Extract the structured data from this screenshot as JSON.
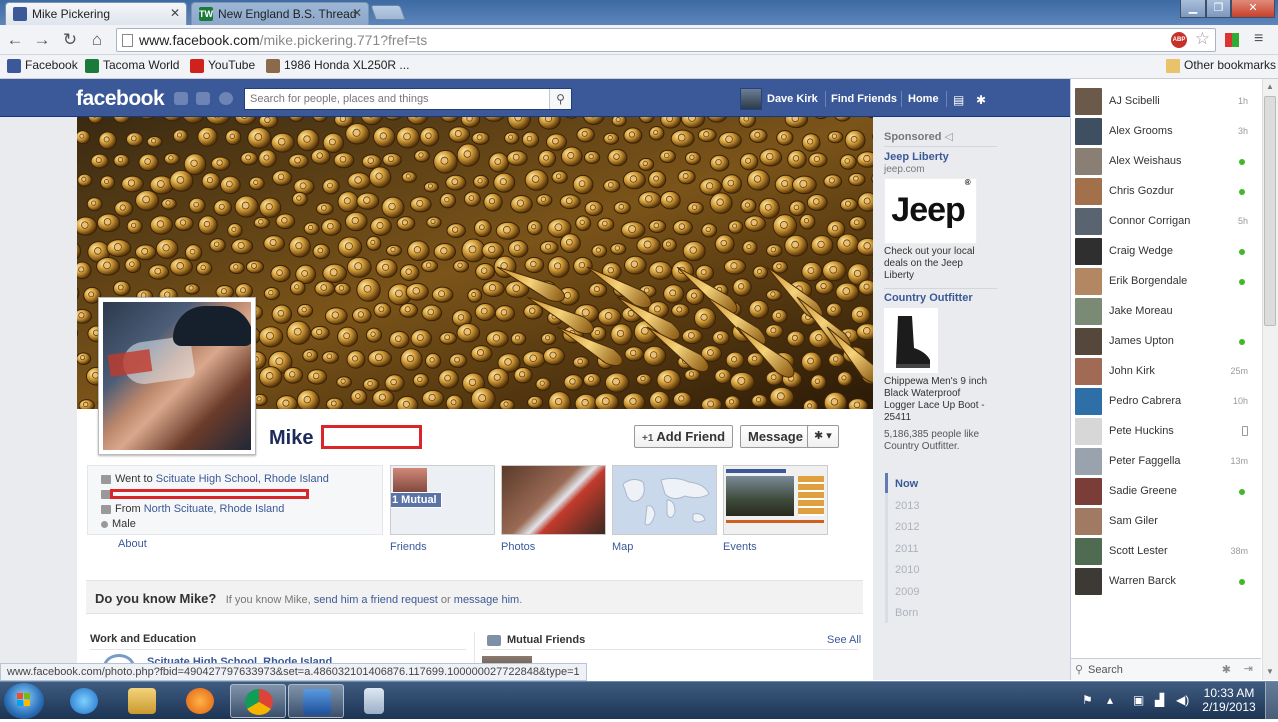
{
  "browser": {
    "tabs": [
      {
        "title": "Mike Pickering",
        "active": true
      },
      {
        "title": "New England B.S. Thread",
        "active": false
      }
    ],
    "url_host": "www.facebook.com",
    "url_rest": "/mike.pickering.771?fref=ts",
    "abp_badge": "ABP",
    "bookmarks": [
      "Facebook",
      "Tacoma World",
      "YouTube",
      "1986 Honda XL250R ..."
    ],
    "other_bookmarks": "Other bookmarks",
    "status_url": "www.facebook.com/photo.php?fbid=490427797633973&set=a.486032101406876.117699.100000027722848&type=1"
  },
  "facebook": {
    "logo": "facebook",
    "search_placeholder": "Search for people, places and things",
    "user_name": "Dave Kirk",
    "find_friends": "Find Friends",
    "home": "Home"
  },
  "profile": {
    "first_name": "Mike",
    "add_friend": "Add Friend",
    "add_friend_icon": "+1",
    "message": "Message",
    "about": {
      "school_prefix": "Went to ",
      "school": "Scituate High School, Rhode Island",
      "from_prefix": "From ",
      "hometown": "North Scituate, Rhode Island",
      "gender": "Male",
      "label": "About"
    },
    "tiles": [
      {
        "label": "Friends",
        "overlay": "1 Mutual"
      },
      {
        "label": "Photos"
      },
      {
        "label": "Map"
      },
      {
        "label": "Events"
      }
    ],
    "know_title": "Do you know Mike?",
    "know_sub_1": "If you know Mike, ",
    "know_link_1": "send him a friend request",
    "know_sub_2": " or ",
    "know_link_2": "message him",
    "know_sub_3": ".",
    "work_heading": "Work and Education",
    "work_item": "Scituate High School, Rhode Island",
    "mutual_heading": "Mutual Friends",
    "see_all": "See All"
  },
  "sidebar": {
    "sponsored": "Sponsored",
    "ads": [
      {
        "title": "Jeep Liberty",
        "domain": "jeep.com",
        "image_text": "Jeep",
        "text": "Check out your local deals on the Jeep Liberty"
      },
      {
        "title": "Country Outfitter",
        "text": "Chippewa Men's 9 inch Black Waterproof Logger Lace Up Boot - 25411",
        "likes": "5,186,385 people like Country Outfitter."
      }
    ],
    "timeline": [
      "Now",
      "2013",
      "2012",
      "2011",
      "2010",
      "2009",
      "Born"
    ]
  },
  "chat": {
    "friends": [
      {
        "name": "AJ Scibelli",
        "status": "1h",
        "color": "#6b5a4a"
      },
      {
        "name": "Alex Grooms",
        "status": "3h",
        "color": "#3f4f62"
      },
      {
        "name": "Alex Weishaus",
        "status": "online",
        "color": "#8a7f75"
      },
      {
        "name": "Chris Gozdur",
        "status": "online",
        "color": "#a2704b"
      },
      {
        "name": "Connor Corrigan",
        "status": "5h",
        "color": "#5a6470"
      },
      {
        "name": "Craig Wedge",
        "status": "online",
        "color": "#2f2f2f"
      },
      {
        "name": "Erik Borgendale",
        "status": "online",
        "color": "#b48763"
      },
      {
        "name": "Jake Moreau",
        "status": "",
        "color": "#7a8a74"
      },
      {
        "name": "James Upton",
        "status": "online",
        "color": "#56473d"
      },
      {
        "name": "John Kirk",
        "status": "25m",
        "color": "#a06a55"
      },
      {
        "name": "Pedro Cabrera",
        "status": "10h",
        "color": "#2f6fa8"
      },
      {
        "name": "Pete Huckins",
        "status": "mobile",
        "color": "#d7d7d7"
      },
      {
        "name": "Peter Faggella",
        "status": "13m",
        "color": "#9aa3ad"
      },
      {
        "name": "Sadie Greene",
        "status": "online",
        "color": "#7b3d37"
      },
      {
        "name": "Sam Giler",
        "status": "",
        "color": "#a07a62"
      },
      {
        "name": "Scott Lester",
        "status": "38m",
        "color": "#4f6b52"
      },
      {
        "name": "Warren Barck",
        "status": "online",
        "color": "#3d3a35"
      }
    ],
    "search": "Search"
  },
  "taskbar": {
    "time": "10:33 AM",
    "date": "2/19/2013"
  }
}
